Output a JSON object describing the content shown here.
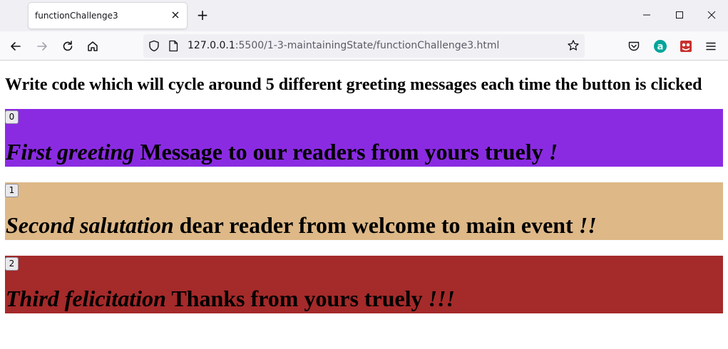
{
  "browser": {
    "tab_title": "functionChallenge3",
    "new_tab_symbol": "+",
    "url_host": "127.0.0.1",
    "url_path": ":5500/1-3-maintainingState/functionChallenge3.html"
  },
  "page": {
    "heading": "Write code which will cycle around 5 different greeting messages each time the button is clicked",
    "greetings": [
      {
        "button_label": "0",
        "greeting": "First greeting",
        "message": " Message to our readers from yours truely ",
        "punct": "!",
        "color": "#8a2be2"
      },
      {
        "button_label": "1",
        "greeting": "Second salutation",
        "message": " dear reader from welcome to main event ",
        "punct": "!!",
        "color": "#deb887"
      },
      {
        "button_label": "2",
        "greeting": "Third felicitation",
        "message": " Thanks from yours truely ",
        "punct": "!!!",
        "color": "#a52a2a"
      }
    ]
  },
  "icons": {
    "tab_close": "close-icon",
    "back": "back-arrow-icon",
    "forward": "forward-arrow-icon",
    "reload": "reload-icon",
    "home": "home-icon",
    "tracking": "shield-icon",
    "page_info": "page-icon",
    "bookmark": "star-icon",
    "pocket": "pocket-icon",
    "extension_a": "extension-a-icon",
    "extension_red": "extension-red-icon",
    "menu": "hamburger-menu-icon",
    "minimize": "minimize-icon",
    "maximize": "maximize-icon",
    "close_window": "close-window-icon"
  }
}
